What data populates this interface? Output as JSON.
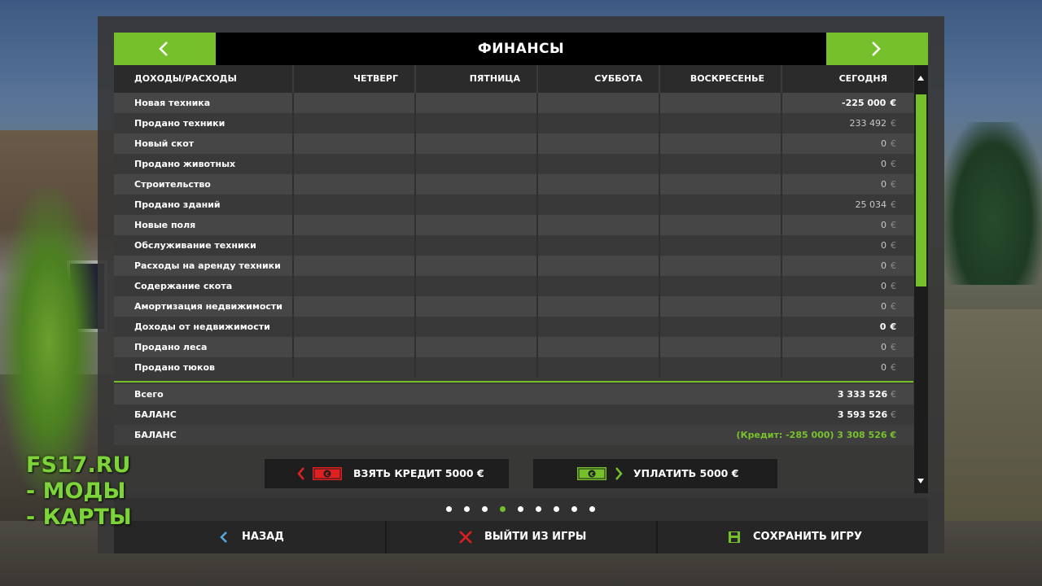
{
  "header": {
    "title": "ФИНАНСЫ"
  },
  "table": {
    "columns": [
      "ДОХОДЫ/РАСХОДЫ",
      "ЧЕТВЕРГ",
      "ПЯТНИЦА",
      "СУББОТА",
      "ВОСКРЕСЕНЬЕ",
      "СЕГОДНЯ"
    ],
    "rows": [
      {
        "label": "Новая техника",
        "today": "-225 000",
        "currency": "€",
        "strong": true
      },
      {
        "label": "Продано техники",
        "today": "233 492",
        "currency": "€",
        "strong": false
      },
      {
        "label": "Новый скот",
        "today": "0",
        "currency": "€",
        "strong": false
      },
      {
        "label": "Продано животных",
        "today": "0",
        "currency": "€",
        "strong": false
      },
      {
        "label": "Строительство",
        "today": "0",
        "currency": "€",
        "strong": false
      },
      {
        "label": "Продано зданий",
        "today": "25 034",
        "currency": "€",
        "strong": false
      },
      {
        "label": "Новые поля",
        "today": "0",
        "currency": "€",
        "strong": false
      },
      {
        "label": "Обслуживание техники",
        "today": "0",
        "currency": "€",
        "strong": false
      },
      {
        "label": "Расходы на аренду техники",
        "today": "0",
        "currency": "€",
        "strong": false
      },
      {
        "label": "Содержание скота",
        "today": "0",
        "currency": "€",
        "strong": false
      },
      {
        "label": "Амортизация недвижимости",
        "today": "0",
        "currency": "€",
        "strong": false
      },
      {
        "label": "Доходы от недвижимости",
        "today": "0",
        "currency": "€",
        "strong": true
      },
      {
        "label": "Продано леса",
        "today": "0",
        "currency": "€",
        "strong": false
      },
      {
        "label": "Продано тюков",
        "today": "0",
        "currency": "€",
        "strong": false
      }
    ]
  },
  "totals": {
    "total_label": "Всего",
    "total_value": "3 333 526",
    "total_currency": "€",
    "balance_label": "БАЛАНС",
    "balance_value": "3 593 526",
    "balance_currency": "€",
    "balance2_label": "БАЛАНС",
    "balance2_value": "(Кредит: -285 000) 3 308 526 €"
  },
  "actions": {
    "take_credit": "ВЗЯТЬ КРЕДИТ 5000 €",
    "pay": "УПЛАТИТЬ 5000 €"
  },
  "pager": {
    "count": 9,
    "active": 3
  },
  "bottom": {
    "back": "НАЗАД",
    "quit": "ВЫЙТИ ИЗ ИГРЫ",
    "save": "СОХРАНИТЬ ИГРУ"
  },
  "watermark": {
    "line1": "FS17.RU",
    "line2": "- МОДЫ",
    "line3": "- КАРТЫ"
  },
  "colors": {
    "accent": "#76c02c",
    "credit_red": "#e02020",
    "header_bg": "#000000"
  }
}
